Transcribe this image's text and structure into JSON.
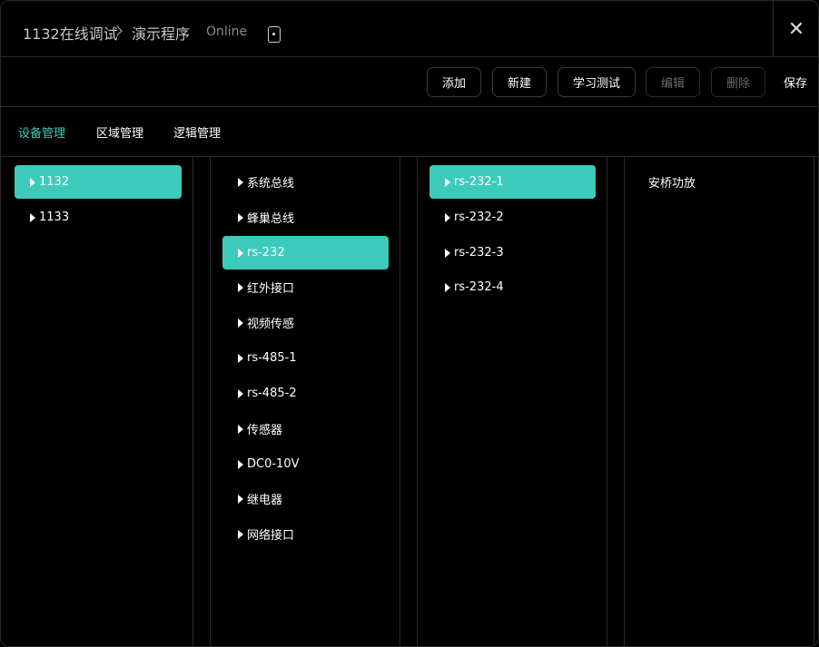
{
  "header": {
    "breadcrumb": "1132在线调试",
    "program": "演示程序",
    "status": "Online",
    "close_symbol": "✕"
  },
  "toolbar": {
    "add": "添加",
    "new": "新建",
    "learn_test": "学习测试",
    "edit": "编辑",
    "delete": "删除",
    "save": "保存"
  },
  "tabs": [
    "设备管理",
    "区域管理",
    "逻辑管理"
  ],
  "devices": [
    "1132",
    "1133"
  ],
  "interfaces": [
    "系统总线",
    "蜂巢总线",
    "rs-232",
    "红外接口",
    "视频传感",
    "rs-485-1",
    "rs-485-2",
    "传感器",
    "DC0-10V",
    "继电器",
    "网络接口"
  ],
  "ports": [
    "rs-232-1",
    "rs-232-2",
    "rs-232-3",
    "rs-232-4"
  ],
  "port_devices": [
    "安桥功放"
  ],
  "colors": {
    "accent": "#3ccbbb",
    "background": "#000000",
    "border": "#2a2a2a"
  }
}
